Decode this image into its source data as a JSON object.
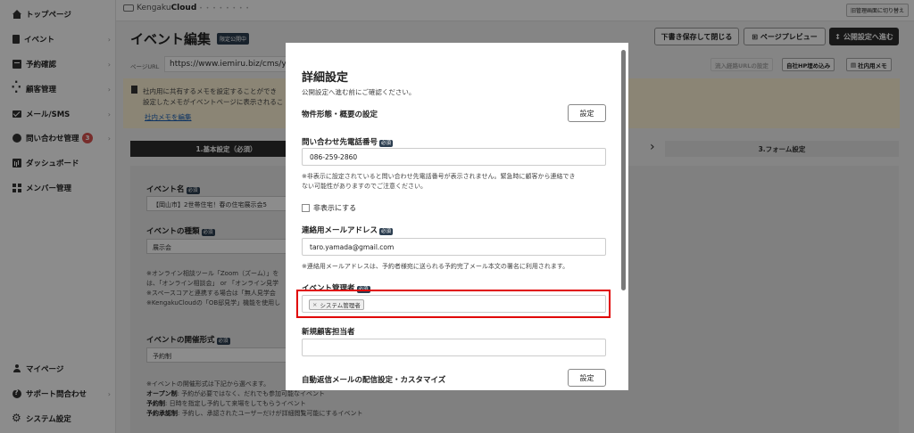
{
  "sidebar": {
    "items": [
      {
        "label": "トップページ",
        "icon": "home-icon"
      },
      {
        "label": "イベント",
        "icon": "document-icon"
      },
      {
        "label": "予約確認",
        "icon": "calendar-icon"
      },
      {
        "label": "顧客管理",
        "icon": "users-icon"
      },
      {
        "label": "メール/SMS",
        "icon": "mail-icon"
      },
      {
        "label": "問い合わせ管理",
        "icon": "chat-icon",
        "badge": "3"
      },
      {
        "label": "ダッシュボード",
        "icon": "chart-icon"
      },
      {
        "label": "メンバー管理",
        "icon": "grid-icon"
      }
    ],
    "bottom": [
      {
        "label": "マイページ",
        "icon": "user-icon"
      },
      {
        "label": "サポート問合わせ",
        "icon": "help-icon"
      },
      {
        "label": "システム設定",
        "icon": "gear-icon"
      }
    ]
  },
  "header": {
    "logo_prefix": "Kengaku",
    "logo_bold": "Cloud",
    "logo_dots": "• • • • • • • •",
    "back_admin": "旧管理画面に切り替え"
  },
  "page": {
    "title": "イベント編集",
    "title_tag": "限定公開中",
    "btn_save_close": "下書き保存して閉じる",
    "btn_preview": "ページプレビュー",
    "btn_next": "公開設定へ進む",
    "url_label": "ページURL",
    "url_value": "https://www.iemiru.biz/cms/yo",
    "btn_url_setting": "流入経路URLの設定",
    "btn_embed": "自社HP埋め込み",
    "btn_memo": "社内用メモ",
    "memo_text": "社内用に共有するメモを設定することができ\n設定したメモがイベントページに表示されるこ",
    "memo_link": "社内メモを編集",
    "step1": "1.基本設定（必須）",
    "step3": "3.フォーム設定"
  },
  "form": {
    "event_name_label": "イベント名",
    "required": "必須",
    "event_name_value": "【岡山市】2世帯住宅！春の住宅展示会5",
    "event_type_label": "イベントの種類",
    "event_type_value": "展示会",
    "type_note": "※オンライン相談ツール「Zoom（ズーム）」を\nは、「オンライン相談会」 or 「オンライン見学\n※スペースコアと連携する場合は「無人見学会\n※KengakuCloudの「OB邸見学」機能を使用し",
    "format_label": "イベントの開催形式",
    "format_value": "予約制",
    "format_note_1": "※イベントの開催形式は下記から選べます。",
    "format_note_open_key": "オープン制",
    "format_note_open": ": 予約が必要ではなく、だれでも参加可能なイベント",
    "format_note_reserve_key": "予約制",
    "format_note_reserve": ": 日時を指定し予約して来場をしてもらうイベント",
    "format_note_approve_key": "予約承認制",
    "format_note_approve": ": 予約し、承認されたユーザーだけが詳細閲覧可能にするイベント"
  },
  "modal": {
    "title": "詳細設定",
    "subtitle": "公開設定へ進む前にご確認ください。",
    "property_label": "物件形態・概要の設定",
    "setting_button": "設定",
    "phone_label": "問い合わせ先電話番号",
    "required": "必須",
    "phone_value": "086-259-2860",
    "phone_note": "※非表示に設定されていると問い合わせ先電話番号が表示されません。緊急時に顧客から連絡でき\nない可能性がありますのでご注意ください。",
    "hide_label": "非表示にする",
    "email_label": "連絡用メールアドレス",
    "email_value": "taro.yamada@gmail.com",
    "email_note": "※連絡用メールアドレスは、予約者様宛に送られる予約完了メール本文の署名に利用されます。",
    "manager_label": "イベント管理者",
    "manager_tag": "システム管理者",
    "manager_tag_remove": "×",
    "new_customer_label": "新規顧客担当者",
    "new_customer_value": "",
    "autoreply_label": "自動返信メールの配信設定・カスタマイズ"
  },
  "colors": {
    "highlight": "#e00000",
    "badge": "#d9534f",
    "required_tag": "#2c3e50",
    "memo_bg": "#fdf3d6"
  }
}
